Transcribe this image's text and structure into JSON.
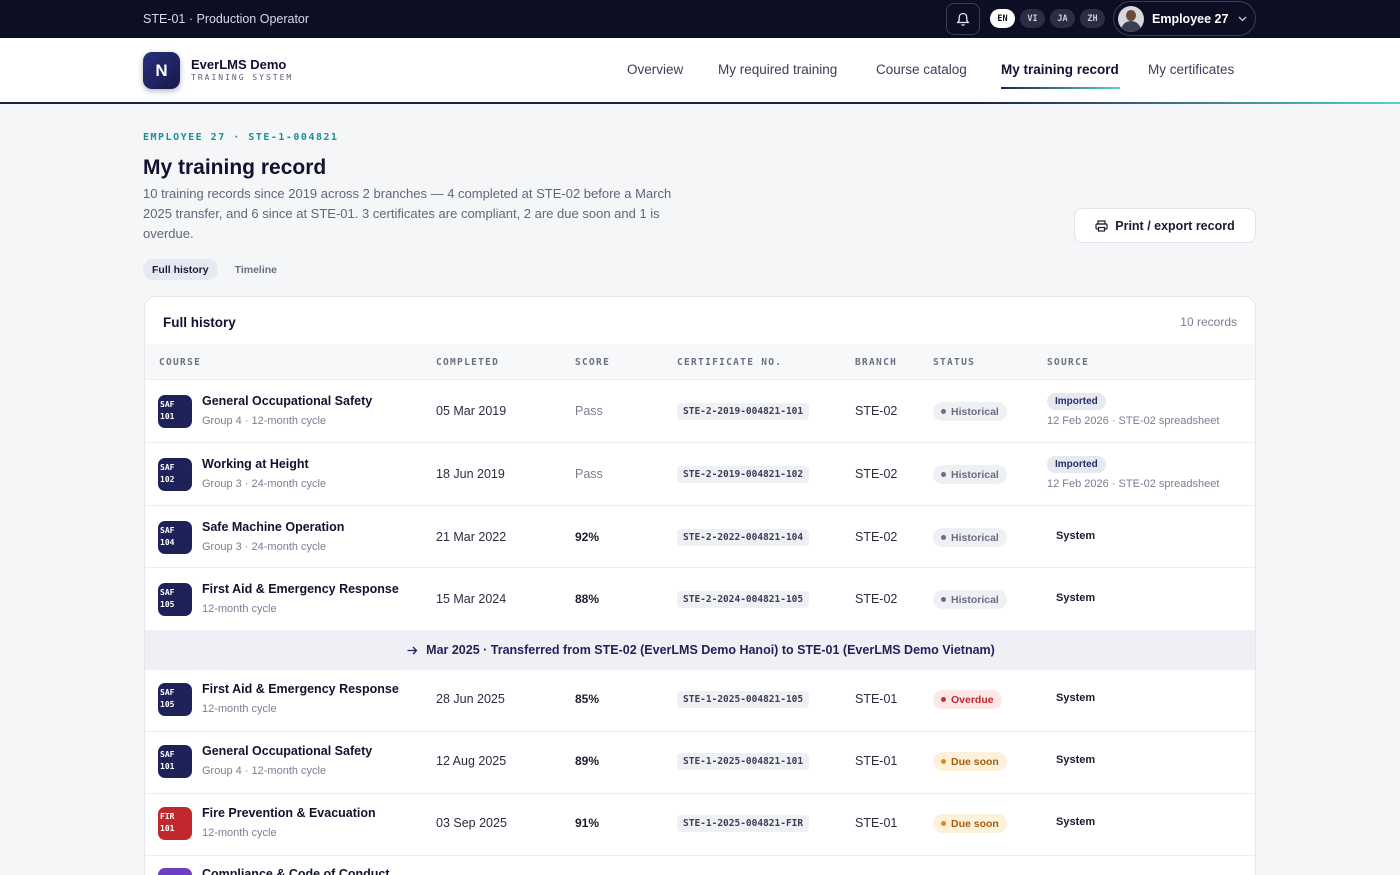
{
  "topbar": {
    "context": "STE-01 · Production Operator",
    "languages": [
      "EN",
      "VI",
      "JA",
      "ZH"
    ],
    "active_language": "EN",
    "user_name": "Employee 27"
  },
  "header": {
    "logo_letter": "N",
    "brand": "EverLMS Demo",
    "brand_sub": "TRAINING SYSTEM",
    "nav": [
      "Overview",
      "My required training",
      "Course catalog",
      "My training record",
      "My certificates"
    ],
    "active_nav": "My training record"
  },
  "page": {
    "eyebrow": "EMPLOYEE 27 · STE-1-004821",
    "title": "My training record",
    "intro": "10 training records since 2019 across 2 branches — 4 completed at STE-02 before a March 2025 transfer, and 6 since at STE-01. 3 certificates are compliant, 2 are due soon and 1 is overdue.",
    "print_label": "Print / export record",
    "view_tabs": [
      "Full history",
      "Timeline"
    ],
    "active_view": "Full history"
  },
  "table": {
    "title": "Full history",
    "count": "10 records",
    "headers": [
      "COURSE",
      "COMPLETED",
      "SCORE",
      "CERTIFICATE NO.",
      "BRANCH",
      "STATUS",
      "SOURCE"
    ],
    "rows": [
      {
        "badge": "SAF 101",
        "name": "General Occupational Safety",
        "meta": "Group 4 · 12-month cycle",
        "completed": "05 Mar 2019",
        "score": "Pass",
        "cert": "STE-2-2019-004821-101",
        "branch": "STE-02",
        "status": "Historical",
        "source_tag": "Imported",
        "source_note": "12 Feb 2026 · STE-02 spreadsheet"
      },
      {
        "badge": "SAF 102",
        "name": "Working at Height",
        "meta": "Group 3 · 24-month cycle",
        "completed": "18 Jun 2019",
        "score": "Pass",
        "cert": "STE-2-2019-004821-102",
        "branch": "STE-02",
        "status": "Historical",
        "source_tag": "Imported",
        "source_note": "12 Feb 2026 · STE-02 spreadsheet"
      },
      {
        "badge": "SAF 104",
        "name": "Safe Machine Operation",
        "meta": "Group 3 · 24-month cycle",
        "completed": "21 Mar 2022",
        "score": "92%",
        "cert": "STE-2-2022-004821-104",
        "branch": "STE-02",
        "status": "Historical",
        "source": "System"
      },
      {
        "badge": "SAF 105",
        "name": "First Aid & Emergency Response",
        "meta": "12-month cycle",
        "completed": "15 Mar 2024",
        "score": "88%",
        "cert": "STE-2-2024-004821-105",
        "branch": "STE-02",
        "status": "Historical",
        "source": "System"
      },
      {
        "badge": "SAF 105",
        "name": "First Aid & Emergency Response",
        "meta": "12-month cycle",
        "completed": "28 Jun 2025",
        "score": "85%",
        "cert": "STE-1-2025-004821-105",
        "branch": "STE-01",
        "status": "Overdue",
        "source": "System"
      },
      {
        "badge": "SAF 101",
        "name": "General Occupational Safety",
        "meta": "Group 4 · 12-month cycle",
        "completed": "12 Aug 2025",
        "score": "89%",
        "cert": "STE-1-2025-004821-101",
        "branch": "STE-01",
        "status": "Due soon",
        "source": "System"
      },
      {
        "badge": "FIR 101",
        "name": "Fire Prevention & Evacuation",
        "meta": "12-month cycle",
        "completed": "03 Sep 2025",
        "score": "91%",
        "cert": "STE-1-2025-004821-FIR",
        "branch": "STE-01",
        "status": "Due soon",
        "source": "System"
      },
      {
        "name": "Compliance & Code of Conduct"
      }
    ],
    "transfer_note": "Mar 2025 · Transferred from STE-02 (EverLMS Demo Hanoi) to STE-01 (EverLMS Demo Vietnam)"
  }
}
